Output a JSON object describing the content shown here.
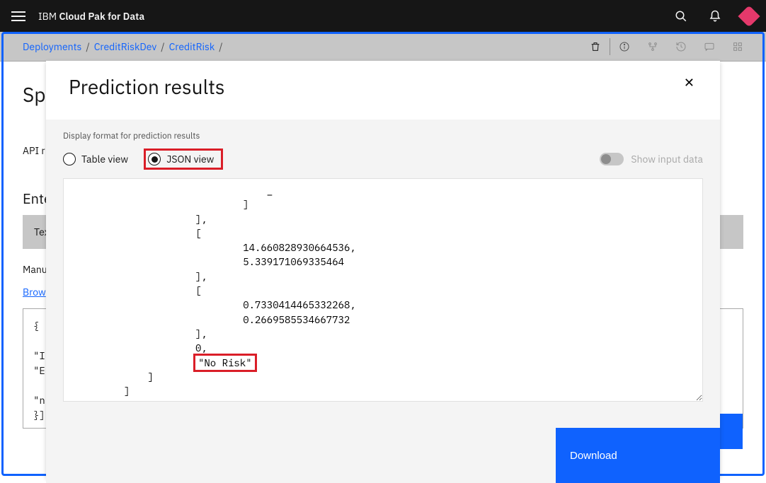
{
  "header": {
    "brand_prefix": "IBM",
    "brand_main": "Cloud Pak for Data"
  },
  "breadcrumb": {
    "items": [
      "Deployments",
      "CreditRiskDev",
      "CreditRisk"
    ]
  },
  "bg": {
    "title_prefix": "Sp",
    "api_label": "API r",
    "enter_label": "Enter",
    "text_label": "Text",
    "manual_label": "Manu",
    "browse_label": "Brow",
    "code_line1": "{ \"",
    "code_line2": "\"I",
    "code_line3": "\"E",
    "code_line4": "\"n",
    "code_line5": "}]}"
  },
  "modal": {
    "title": "Prediction results",
    "display_label": "Display format for prediction results",
    "table_view_label": "Table view",
    "json_view_label": "JSON view",
    "show_input_label": "Show input data",
    "download_label": "Download",
    "json_pre": "                                _\n                            ]\n                    ],\n                    [\n                            14.660828930664536,\n                            5.339171069335464\n                    ],\n                    [\n                            0.7330414465332268,\n                            0.2669585534667732\n                    ],\n                    0,\n",
    "json_risk": "\"No Risk\"",
    "json_post": "\n            ]\n        ]\n}"
  }
}
